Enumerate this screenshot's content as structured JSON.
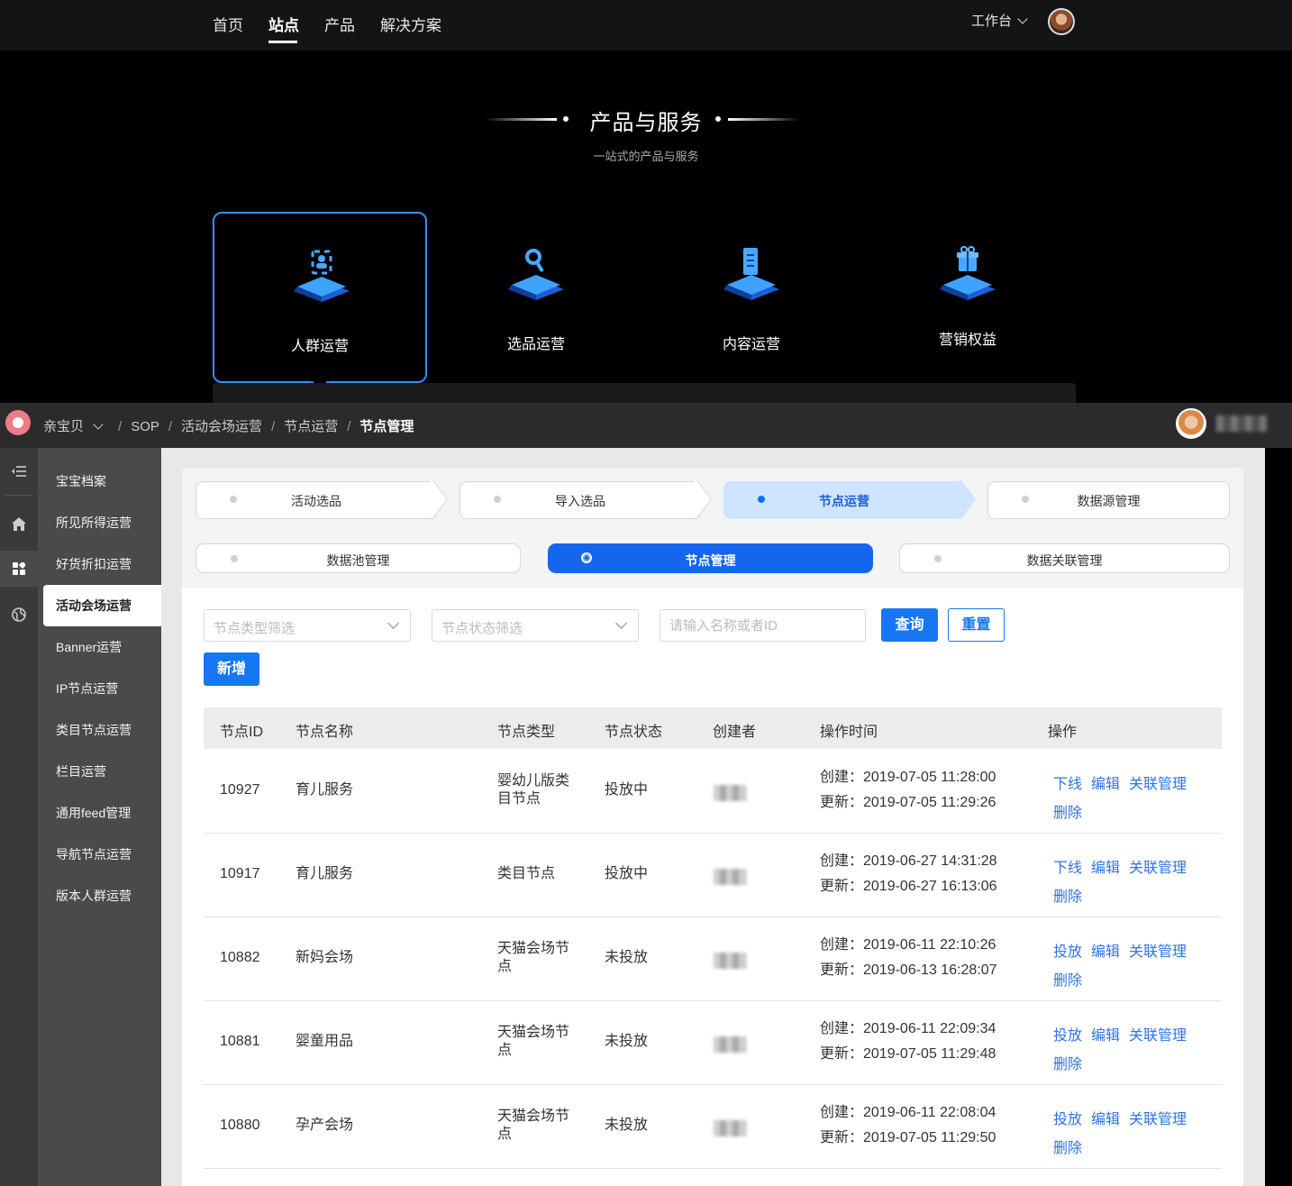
{
  "top_nav": {
    "items": [
      "首页",
      "站点",
      "产品",
      "解决方案"
    ],
    "active_index": 1,
    "workbench_label": "工作台"
  },
  "hero": {
    "title": "产品与服务",
    "subtitle": "一站式的产品与服务",
    "services": [
      {
        "label": "人群运营",
        "icon": "user-scan-icon",
        "active": true
      },
      {
        "label": "选品运营",
        "icon": "search-product-icon",
        "active": false
      },
      {
        "label": "内容运营",
        "icon": "document-icon",
        "active": false
      },
      {
        "label": "营销权益",
        "icon": "gift-icon",
        "active": false
      }
    ]
  },
  "app_header": {
    "app_name": "亲宝贝",
    "breadcrumb": [
      "SOP",
      "活动会场运营",
      "节点运营",
      "节点管理"
    ]
  },
  "rail_icons": [
    "menu-collapse-icon",
    "home-icon",
    "grid-icon",
    "globe-icon"
  ],
  "sidebar": {
    "items": [
      "宝宝档案",
      "所见所得运营",
      "好货折扣运营",
      "活动会场运营",
      "Banner运营",
      "IP节点运营",
      "类目节点运营",
      "栏目运营",
      "通用feed管理",
      "导航节点运营",
      "版本人群运营"
    ],
    "active_index": 3
  },
  "steps": [
    {
      "label": "活动选品",
      "active": false
    },
    {
      "label": "导入选品",
      "active": false
    },
    {
      "label": "节点运营",
      "active": true
    },
    {
      "label": "数据源管理",
      "active": false
    }
  ],
  "sub_tabs": [
    {
      "label": "数据池管理",
      "active": false
    },
    {
      "label": "节点管理",
      "active": true
    },
    {
      "label": "数据关联管理",
      "active": false
    }
  ],
  "filters": {
    "type_placeholder": "节点类型筛选",
    "status_placeholder": "节点状态筛选",
    "search_placeholder": "请输入名称或者ID",
    "query_label": "查询",
    "reset_label": "重置",
    "add_label": "新增"
  },
  "table": {
    "columns": [
      "节点ID",
      "节点名称",
      "节点类型",
      "节点状态",
      "创建者",
      "操作时间",
      "操作"
    ],
    "rows": [
      {
        "id": "10927",
        "name": "育儿服务",
        "type": "婴幼儿版类目节点",
        "status": "投放中",
        "created": "创建：2019-07-05 11:28:00",
        "updated": "更新：2019-07-05 11:29:26",
        "actions": [
          "下线",
          "编辑",
          "关联管理",
          "删除"
        ]
      },
      {
        "id": "10917",
        "name": "育儿服务",
        "type": "类目节点",
        "status": "投放中",
        "created": "创建：2019-06-27 14:31:28",
        "updated": "更新：2019-06-27 16:13:06",
        "actions": [
          "下线",
          "编辑",
          "关联管理",
          "删除"
        ]
      },
      {
        "id": "10882",
        "name": "新妈会场",
        "type": "天猫会场节点",
        "status": "未投放",
        "created": "创建：2019-06-11 22:10:26",
        "updated": "更新：2019-06-13 16:28:07",
        "actions": [
          "投放",
          "编辑",
          "关联管理",
          "删除"
        ]
      },
      {
        "id": "10881",
        "name": "婴童用品",
        "type": "天猫会场节点",
        "status": "未投放",
        "created": "创建：2019-06-11 22:09:34",
        "updated": "更新：2019-07-05 11:29:48",
        "actions": [
          "投放",
          "编辑",
          "关联管理",
          "删除"
        ]
      },
      {
        "id": "10880",
        "name": "孕产会场",
        "type": "天猫会场节点",
        "status": "未投放",
        "created": "创建：2019-06-11 22:08:04",
        "updated": "更新：2019-07-05 11:29:50",
        "actions": [
          "投放",
          "编辑",
          "关联管理",
          "删除"
        ]
      }
    ]
  },
  "colors": {
    "primary": "#1677f5",
    "link": "#2e73e8",
    "active_step_bg": "#cfe4ff",
    "hero_highlight": "#3a8dff"
  }
}
